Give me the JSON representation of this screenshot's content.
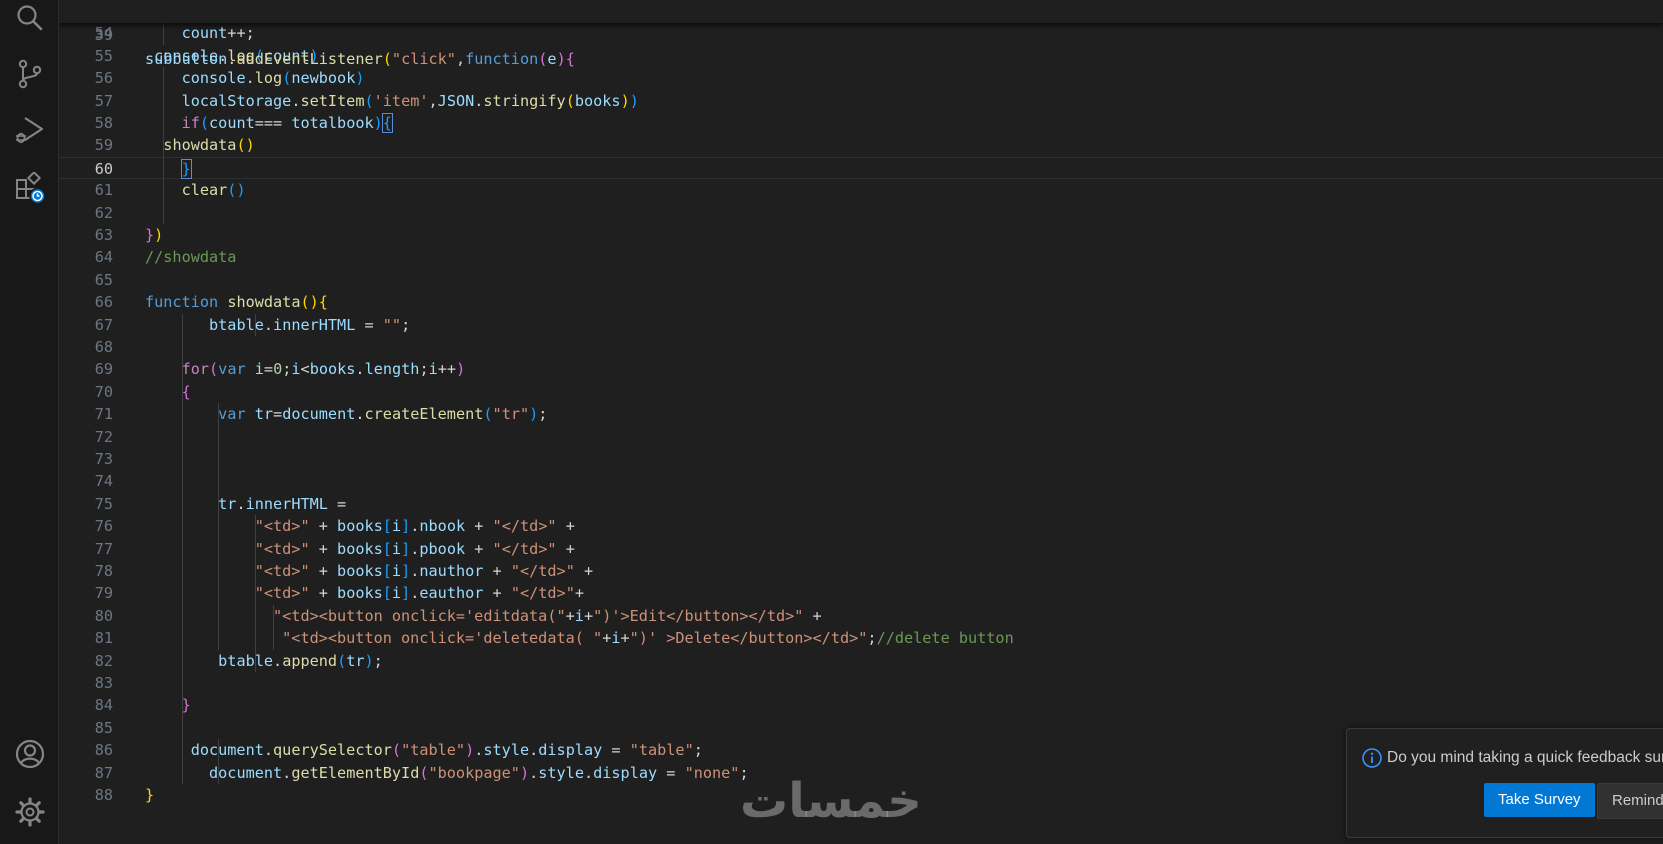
{
  "activity_bar": {
    "top_icons": [
      "search-icon",
      "source-control-icon",
      "run-debug-icon",
      "extensions-update-icon"
    ],
    "bottom_icons": [
      "account-icon",
      "gear-icon"
    ]
  },
  "colors": {
    "plain": "#d4d4d4",
    "var": "#9cdcfe",
    "func": "#dcdcaa",
    "keyword": "#569cd6",
    "control": "#c586c0",
    "string": "#ce9178",
    "comment": "#6a9955",
    "number": "#b5cea8",
    "bracket1": "#ffd700",
    "bracket2": "#da70d6",
    "bracket3": "#179fff"
  },
  "sticky_line": {
    "number": "39",
    "tokens": [
      [
        "subbutton",
        "var"
      ],
      [
        ".",
        ""
      ],
      [
        "addEventListener",
        "func"
      ],
      [
        "(",
        "bracket1"
      ],
      [
        "\"click\"",
        "string"
      ],
      [
        ",",
        ""
      ],
      [
        "function",
        "keyword"
      ],
      [
        "(",
        "bracket2"
      ],
      [
        "e",
        "var"
      ],
      [
        ")",
        "bracket2"
      ],
      [
        "{",
        "bracket2"
      ]
    ]
  },
  "editor": {
    "active_line": "60",
    "lines": [
      {
        "n": "54",
        "g": [
          1
        ],
        "tokens": [
          [
            "    ",
            ""
          ],
          [
            "count",
            "var"
          ],
          [
            "++;",
            ""
          ]
        ]
      },
      {
        "n": "55",
        "g": [],
        "tokens": [
          [
            " ",
            ""
          ],
          [
            "console",
            "var"
          ],
          [
            ".",
            ""
          ],
          [
            "log",
            "func"
          ],
          [
            "(",
            "bracket3"
          ],
          [
            "count",
            "var"
          ],
          [
            ")",
            "bracket3"
          ]
        ]
      },
      {
        "n": "56",
        "g": [
          1
        ],
        "tokens": [
          [
            "    ",
            ""
          ],
          [
            "console",
            "var"
          ],
          [
            ".",
            ""
          ],
          [
            "log",
            "func"
          ],
          [
            "(",
            "bracket3"
          ],
          [
            "newbook",
            "var"
          ],
          [
            ")",
            "bracket3"
          ]
        ]
      },
      {
        "n": "57",
        "g": [
          1
        ],
        "tokens": [
          [
            "    ",
            ""
          ],
          [
            "localStorage",
            "var"
          ],
          [
            ".",
            ""
          ],
          [
            "setItem",
            "func"
          ],
          [
            "(",
            "bracket3"
          ],
          [
            "'item'",
            "string"
          ],
          [
            ",",
            ""
          ],
          [
            "JSON",
            "var"
          ],
          [
            ".",
            ""
          ],
          [
            "stringify",
            "func"
          ],
          [
            "(",
            "bracket1"
          ],
          [
            "books",
            "var"
          ],
          [
            ")",
            "bracket1"
          ],
          [
            ")",
            "bracket3"
          ]
        ]
      },
      {
        "n": "58",
        "g": [
          1
        ],
        "tokens": [
          [
            "    ",
            ""
          ],
          [
            "if",
            "control"
          ],
          [
            "(",
            "bracket3"
          ],
          [
            "count",
            "var"
          ],
          [
            "=== ",
            ""
          ],
          [
            "totalbook",
            "var"
          ],
          [
            ")",
            "bracket3"
          ],
          [
            "{",
            "bracket3",
            "box"
          ]
        ]
      },
      {
        "n": "59",
        "g": [
          1
        ],
        "tokens": [
          [
            "  ",
            ""
          ],
          [
            "showdata",
            "func"
          ],
          [
            "(",
            "bracket1"
          ],
          [
            ")",
            "bracket1"
          ]
        ]
      },
      {
        "n": "60",
        "g": [
          1
        ],
        "tokens": [
          [
            "    ",
            ""
          ],
          [
            "}",
            "bracket3",
            "box"
          ]
        ]
      },
      {
        "n": "61",
        "g": [
          1
        ],
        "tokens": [
          [
            "    ",
            ""
          ],
          [
            "clear",
            "func"
          ],
          [
            "(",
            "bracket3"
          ],
          [
            ")",
            "bracket3"
          ]
        ]
      },
      {
        "n": "62",
        "g": [
          1
        ],
        "tokens": []
      },
      {
        "n": "63",
        "g": [],
        "tokens": [
          [
            "}",
            "bracket2"
          ],
          [
            ")",
            "bracket1"
          ]
        ]
      },
      {
        "n": "64",
        "g": [],
        "tokens": [
          [
            "//showdata",
            "comment"
          ]
        ]
      },
      {
        "n": "65",
        "g": [],
        "tokens": []
      },
      {
        "n": "66",
        "g": [],
        "tokens": [
          [
            "function",
            "keyword"
          ],
          [
            " ",
            ""
          ],
          [
            "showdata",
            "func"
          ],
          [
            "(",
            "bracket1"
          ],
          [
            ")",
            "bracket1"
          ],
          [
            "{",
            "bracket1"
          ]
        ]
      },
      {
        "n": "67",
        "g": [
          0,
          2
        ],
        "tokens": [
          [
            "       ",
            ""
          ],
          [
            "btable",
            "var"
          ],
          [
            ".",
            ""
          ],
          [
            "innerHTML",
            "var"
          ],
          [
            " = ",
            ""
          ],
          [
            "\"\"",
            "string"
          ],
          [
            ";",
            ""
          ]
        ]
      },
      {
        "n": "68",
        "g": [
          0
        ],
        "tokens": []
      },
      {
        "n": "69",
        "g": [
          0
        ],
        "tokens": [
          [
            "    ",
            ""
          ],
          [
            "for",
            "control"
          ],
          [
            "(",
            "bracket2"
          ],
          [
            "var",
            "keyword"
          ],
          [
            " ",
            ""
          ],
          [
            "i",
            "var"
          ],
          [
            "=",
            ""
          ],
          [
            "0",
            "number"
          ],
          [
            ";",
            ""
          ],
          [
            "i",
            "var"
          ],
          [
            "<",
            ""
          ],
          [
            "books",
            "var"
          ],
          [
            ".",
            ""
          ],
          [
            "length",
            "var"
          ],
          [
            ";",
            ""
          ],
          [
            "i",
            "var"
          ],
          [
            "++",
            ""
          ],
          [
            ")",
            "bracket2"
          ]
        ]
      },
      {
        "n": "70",
        "g": [
          0
        ],
        "tokens": [
          [
            "    ",
            ""
          ],
          [
            "{",
            "bracket2"
          ]
        ]
      },
      {
        "n": "71",
        "g": [
          0,
          1
        ],
        "tokens": [
          [
            "        ",
            ""
          ],
          [
            "var",
            "keyword"
          ],
          [
            " ",
            ""
          ],
          [
            "tr",
            "var"
          ],
          [
            "=",
            ""
          ],
          [
            "document",
            "var"
          ],
          [
            ".",
            ""
          ],
          [
            "createElement",
            "func"
          ],
          [
            "(",
            "bracket3"
          ],
          [
            "\"tr\"",
            "string"
          ],
          [
            ")",
            "bracket3"
          ],
          [
            ";",
            ""
          ]
        ]
      },
      {
        "n": "72",
        "g": [
          0,
          1
        ],
        "tokens": []
      },
      {
        "n": "73",
        "g": [
          0,
          1
        ],
        "tokens": []
      },
      {
        "n": "74",
        "g": [
          0,
          1
        ],
        "tokens": []
      },
      {
        "n": "75",
        "g": [
          0,
          1
        ],
        "tokens": [
          [
            "        ",
            ""
          ],
          [
            "tr",
            "var"
          ],
          [
            ".",
            ""
          ],
          [
            "innerHTML",
            "var"
          ],
          [
            " =",
            ""
          ]
        ]
      },
      {
        "n": "76",
        "g": [
          0,
          1,
          2
        ],
        "tokens": [
          [
            "            ",
            ""
          ],
          [
            "\"<td>\"",
            "string"
          ],
          [
            " + ",
            ""
          ],
          [
            "books",
            "var"
          ],
          [
            "[",
            "bracket3"
          ],
          [
            "i",
            "var"
          ],
          [
            "]",
            "bracket3"
          ],
          [
            ".",
            ""
          ],
          [
            "nbook",
            "var"
          ],
          [
            " + ",
            ""
          ],
          [
            "\"</td>\"",
            "string"
          ],
          [
            " +",
            ""
          ]
        ]
      },
      {
        "n": "77",
        "g": [
          0,
          1,
          2
        ],
        "tokens": [
          [
            "            ",
            ""
          ],
          [
            "\"<td>\"",
            "string"
          ],
          [
            " + ",
            ""
          ],
          [
            "books",
            "var"
          ],
          [
            "[",
            "bracket3"
          ],
          [
            "i",
            "var"
          ],
          [
            "]",
            "bracket3"
          ],
          [
            ".",
            ""
          ],
          [
            "pbook",
            "var"
          ],
          [
            " + ",
            ""
          ],
          [
            "\"</td>\"",
            "string"
          ],
          [
            " +",
            ""
          ]
        ]
      },
      {
        "n": "78",
        "g": [
          0,
          1,
          2
        ],
        "tokens": [
          [
            "            ",
            ""
          ],
          [
            "\"<td>\"",
            "string"
          ],
          [
            " + ",
            ""
          ],
          [
            "books",
            "var"
          ],
          [
            "[",
            "bracket3"
          ],
          [
            "i",
            "var"
          ],
          [
            "]",
            "bracket3"
          ],
          [
            ".",
            ""
          ],
          [
            "nauthor",
            "var"
          ],
          [
            " + ",
            ""
          ],
          [
            "\"</td>\"",
            "string"
          ],
          [
            " +",
            ""
          ]
        ]
      },
      {
        "n": "79",
        "g": [
          0,
          1,
          2
        ],
        "tokens": [
          [
            "            ",
            ""
          ],
          [
            "\"<td>\"",
            "string"
          ],
          [
            " + ",
            ""
          ],
          [
            "books",
            "var"
          ],
          [
            "[",
            "bracket3"
          ],
          [
            "i",
            "var"
          ],
          [
            "]",
            "bracket3"
          ],
          [
            ".",
            ""
          ],
          [
            "eauthor",
            "var"
          ],
          [
            " + ",
            ""
          ],
          [
            "\"</td>\"",
            "string"
          ],
          [
            "+",
            ""
          ]
        ]
      },
      {
        "n": "80",
        "g": [
          0,
          1,
          2,
          3
        ],
        "tokens": [
          [
            "              ",
            ""
          ],
          [
            "\"<td><button onclick='editdata(\"",
            "string"
          ],
          [
            "+",
            ""
          ],
          [
            "i",
            "var"
          ],
          [
            "+",
            ""
          ],
          [
            "\")'>Edit</button></td>\"",
            "string"
          ],
          [
            " +",
            ""
          ]
        ]
      },
      {
        "n": "81",
        "g": [
          0,
          1,
          2,
          3
        ],
        "tokens": [
          [
            "               ",
            ""
          ],
          [
            "\"<td><button onclick='deletedata( \"",
            "string"
          ],
          [
            "+",
            ""
          ],
          [
            "i",
            "var"
          ],
          [
            "+",
            ""
          ],
          [
            "\")' >Delete</button></td>\"",
            "string"
          ],
          [
            ";",
            ""
          ],
          [
            "//delete button",
            "comment"
          ]
        ]
      },
      {
        "n": "82",
        "g": [
          0,
          2
        ],
        "tokens": [
          [
            "        ",
            ""
          ],
          [
            "btable",
            "var"
          ],
          [
            ".",
            ""
          ],
          [
            "append",
            "func"
          ],
          [
            "(",
            "bracket3"
          ],
          [
            "tr",
            "var"
          ],
          [
            ")",
            "bracket3"
          ],
          [
            ";",
            ""
          ]
        ]
      },
      {
        "n": "83",
        "g": [
          0
        ],
        "tokens": []
      },
      {
        "n": "84",
        "g": [
          0
        ],
        "tokens": [
          [
            "    ",
            ""
          ],
          [
            "}",
            "bracket2"
          ]
        ]
      },
      {
        "n": "85",
        "g": [
          0
        ],
        "tokens": []
      },
      {
        "n": "86",
        "g": [
          0,
          1
        ],
        "tokens": [
          [
            "     ",
            ""
          ],
          [
            "document",
            "var"
          ],
          [
            ".",
            ""
          ],
          [
            "querySelector",
            "func"
          ],
          [
            "(",
            "bracket2"
          ],
          [
            "\"table\"",
            "string"
          ],
          [
            ")",
            "bracket2"
          ],
          [
            ".",
            ""
          ],
          [
            "style",
            "var"
          ],
          [
            ".",
            ""
          ],
          [
            "display",
            "var"
          ],
          [
            " = ",
            ""
          ],
          [
            "\"table\"",
            "string"
          ],
          [
            ";",
            ""
          ]
        ]
      },
      {
        "n": "87",
        "g": [
          0,
          1
        ],
        "tokens": [
          [
            "       ",
            ""
          ],
          [
            "document",
            "var"
          ],
          [
            ".",
            ""
          ],
          [
            "getElementById",
            "func"
          ],
          [
            "(",
            "bracket2"
          ],
          [
            "\"bookpage\"",
            "string"
          ],
          [
            ")",
            "bracket2"
          ],
          [
            ".",
            ""
          ],
          [
            "style",
            "var"
          ],
          [
            ".",
            ""
          ],
          [
            "display",
            "var"
          ],
          [
            " = ",
            ""
          ],
          [
            "\"none\"",
            "string"
          ],
          [
            ";",
            ""
          ]
        ]
      },
      {
        "n": "88",
        "g": [],
        "tokens": [
          [
            "}",
            "bracket1"
          ]
        ]
      }
    ]
  },
  "notification": {
    "message": "Do you mind taking a quick feedback survey?",
    "primary_button": "Take Survey",
    "secondary_button": "Remind Me Later"
  },
  "watermark": "خمسات"
}
